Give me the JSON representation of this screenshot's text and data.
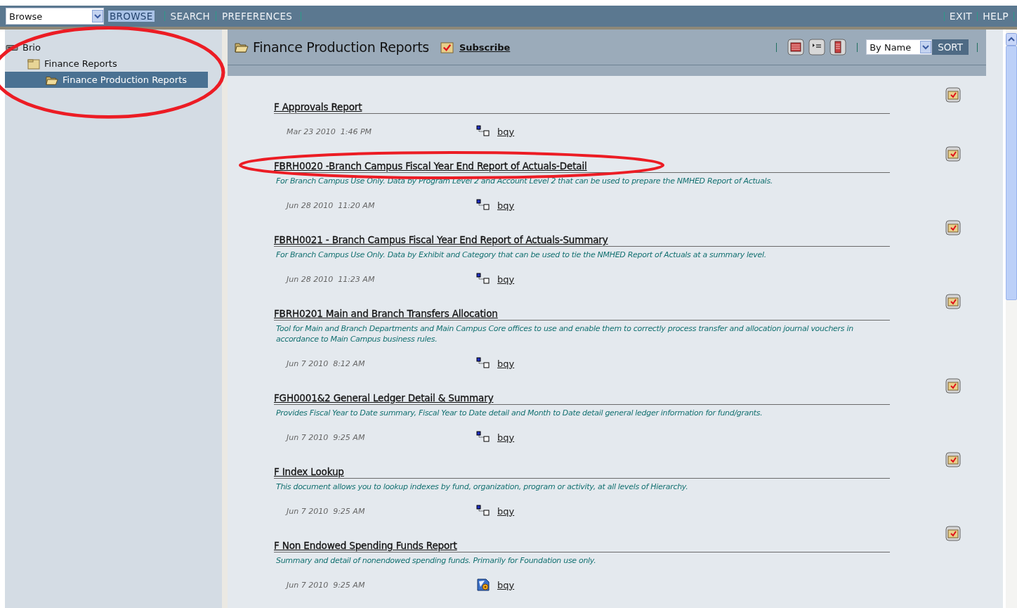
{
  "nav": {
    "view_select": "Browse",
    "links": [
      {
        "label": "BROWSE",
        "selected": true
      },
      {
        "label": "SEARCH",
        "selected": false
      },
      {
        "label": "PREFERENCES",
        "selected": false
      }
    ],
    "right_links": [
      "EXIT",
      "HELP"
    ]
  },
  "tree": {
    "circled": true,
    "items": [
      {
        "label": "Brio",
        "kind": "root",
        "selected": false,
        "children": [
          {
            "label": "Finance Reports",
            "kind": "folder",
            "selected": false,
            "children": [
              {
                "label": "Finance Production Reports",
                "kind": "open-folder",
                "selected": true
              }
            ]
          }
        ]
      }
    ]
  },
  "header": {
    "title": "Finance Production Reports",
    "subscribe": "Subscribe",
    "sort_select": "By Name",
    "sort_button": "SORT"
  },
  "reports": [
    {
      "title": "F Approvals Report",
      "date": "Mar 23 2010  1:46 PM",
      "kind": "job",
      "owner": "bqy",
      "circled": false
    },
    {
      "title": "FBRH0020 -Branch Campus Fiscal Year End Report of Actuals-Detail",
      "description": "For Branch Campus Use Only. Data by Program Level 2 and Account Level 2 that can be used to prepare the NMHED Report of Actuals.",
      "date": "Jun 28 2010  11:20 AM",
      "kind": "job",
      "owner": "bqy",
      "circled": true
    },
    {
      "title": "FBRH0021 - Branch Campus Fiscal Year End Report of Actuals-Summary",
      "description": "For Branch Campus Use Only. Data by Exhibit and Category that can be used to tie the NMHED Report of Actuals at a summary level.",
      "date": "Jun 28 2010  11:23 AM",
      "kind": "job",
      "owner": "bqy",
      "circled": false
    },
    {
      "title": "FBRH0201 Main and Branch Transfers Allocation",
      "description": "Tool for Main and Branch Departments and Main Campus Core offices to use and enable them to correctly process transfer and allocation journal vouchers in accordance to Main Campus business rules.",
      "date": "Jun 7 2010  8:12 AM",
      "kind": "job",
      "owner": "bqy",
      "circled": false
    },
    {
      "title": "FGH0001&2 General Ledger Detail & Summary",
      "description": "Provides Fiscal Year to Date summary, Fiscal Year to Date detail and Month to Date detail general ledger information for fund/grants.",
      "date": "Jun 7 2010  9:25 AM",
      "kind": "job",
      "owner": "bqy",
      "circled": false
    },
    {
      "title": "F Index Lookup",
      "description": "This document allows you to lookup indexes by fund, organization, program or activity, at all levels of Hierarchy.",
      "date": "Jun 7 2010  9:25 AM",
      "kind": "job",
      "owner": "bqy",
      "circled": false
    },
    {
      "title": "F Non Endowed Spending Funds Report",
      "description": "Summary and detail of nonendowed spending funds. Primarily for Foundation use only.",
      "date": "Jun 7 2010  9:25 AM",
      "kind": "document",
      "owner": "bqy",
      "circled": false
    }
  ]
}
